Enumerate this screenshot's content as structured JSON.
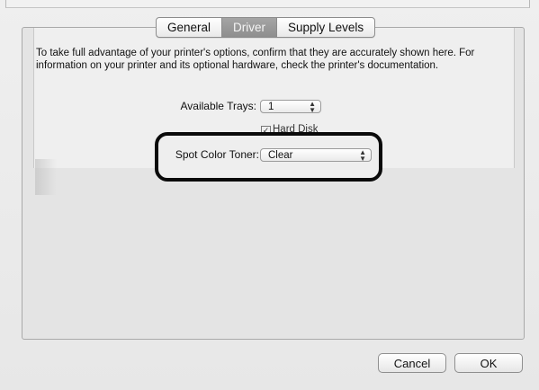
{
  "tabs": [
    {
      "label": "General",
      "selected": false
    },
    {
      "label": "Driver",
      "selected": true
    },
    {
      "label": "Supply Levels",
      "selected": false
    }
  ],
  "description": "To take full advantage of your printer's options, confirm that they are accurately shown here. For information on your printer and its optional hardware, check the printer's documentation.",
  "options": {
    "available_trays": {
      "label": "Available Trays:",
      "value": "1"
    },
    "hard_disk": {
      "label": "Hard Disk",
      "checked": true
    },
    "spot_color_toner": {
      "label": "Spot Color Toner:",
      "value": "Clear"
    }
  },
  "buttons": {
    "cancel": "Cancel",
    "ok": "OK"
  },
  "colors": {
    "selected_tab": "#969696",
    "highlight_border": "#0a0a0a",
    "window_bg": "#ececec"
  }
}
